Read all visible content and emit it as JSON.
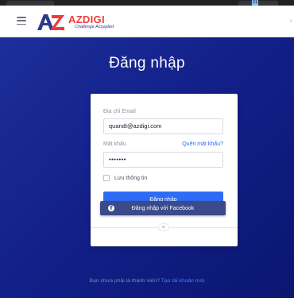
{
  "browser": {
    "badge": "21"
  },
  "header": {
    "brand_name": "AZDIGI",
    "brand_tagline": "Challenge Accepted",
    "menu_icon": "hamburger-icon"
  },
  "login": {
    "title": "Đăng nhập",
    "email_label": "Địa chỉ Email",
    "email_value": "quandt@azdigi.com",
    "password_label": "Mật khẩu",
    "forgot_link": "Quên mật khẩu?",
    "password_value": "•••••••",
    "remember_label": "Lưu thông tin",
    "remember_checked": false,
    "submit_label": "Đăng nhập",
    "divider_text": "or",
    "facebook_label": "Đăng nhập với Facebook",
    "signup_prompt": "Bạn chưa phải là thành viên?",
    "signup_link": "Tạo tài khoản mới"
  },
  "colors": {
    "hero_bg": "#13208a",
    "primary_button": "#2f6cf5",
    "facebook_button": "#3b4a8a",
    "brand_red": "#ef3b3b"
  }
}
